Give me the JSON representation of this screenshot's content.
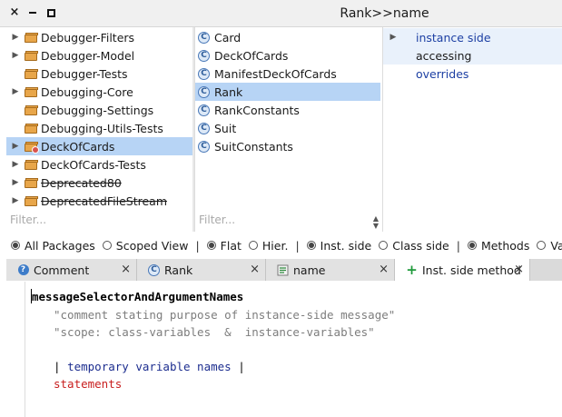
{
  "window": {
    "title": "Rank>>name",
    "close_glyph": "×"
  },
  "packages": {
    "items": [
      {
        "label": "Debugger-Filters",
        "has_arrow": true,
        "selected": false,
        "deprecated": false
      },
      {
        "label": "Debugger-Model",
        "has_arrow": true,
        "selected": false,
        "deprecated": false
      },
      {
        "label": "Debugger-Tests",
        "has_arrow": false,
        "selected": false,
        "deprecated": false
      },
      {
        "label": "Debugging-Core",
        "has_arrow": true,
        "selected": false,
        "deprecated": false
      },
      {
        "label": "Debugging-Settings",
        "has_arrow": false,
        "selected": false,
        "deprecated": false
      },
      {
        "label": "Debugging-Utils-Tests",
        "has_arrow": false,
        "selected": false,
        "deprecated": false
      },
      {
        "label": "DeckOfCards",
        "has_arrow": true,
        "selected": true,
        "deprecated": false
      },
      {
        "label": "DeckOfCards-Tests",
        "has_arrow": true,
        "selected": false,
        "deprecated": false
      },
      {
        "label": "Deprecated80",
        "has_arrow": true,
        "selected": false,
        "deprecated": true
      },
      {
        "label": "DeprecatedFileStream",
        "has_arrow": true,
        "selected": false,
        "deprecated": true
      }
    ],
    "filter_placeholder": "Filter..."
  },
  "classes": {
    "items": [
      {
        "label": "Card",
        "selected": false
      },
      {
        "label": "DeckOfCards",
        "selected": false
      },
      {
        "label": "ManifestDeckOfCards",
        "selected": false
      },
      {
        "label": "Rank",
        "selected": true
      },
      {
        "label": "RankConstants",
        "selected": false
      },
      {
        "label": "Suit",
        "selected": false
      },
      {
        "label": "SuitConstants",
        "selected": false
      }
    ],
    "filter_placeholder": "Filter...",
    "icon_glyph": "C"
  },
  "protocols": {
    "items": [
      {
        "label": "instance side",
        "link": true,
        "arrow": true
      },
      {
        "label": "accessing",
        "link": false,
        "arrow": false
      },
      {
        "label": "overrides",
        "link": true,
        "arrow": false
      }
    ]
  },
  "options": {
    "all_packages": "All Packages",
    "scoped_view": "Scoped View",
    "flat": "Flat",
    "hier": "Hier.",
    "inst_side": "Inst. side",
    "class_side": "Class side",
    "methods": "Methods",
    "vars": "Vars",
    "separator": "|"
  },
  "tabs": [
    {
      "label": "Comment",
      "icon": "question-icon",
      "icon_glyph": "?"
    },
    {
      "label": "Rank",
      "icon": "class-icon",
      "icon_glyph": "C"
    },
    {
      "label": "name",
      "icon": "method-icon",
      "icon_glyph": ""
    },
    {
      "label": "Inst. side method",
      "icon": "plus-icon",
      "icon_glyph": "+"
    }
  ],
  "editor": {
    "signature": "messageSelectorAndArgumentNames",
    "comment_line": "\"comment stating purpose of instance-side message\"",
    "scope_line": "\"scope: class-variables  &  instance-variables\"",
    "temporaries_open": "| ",
    "temporaries_text": "temporary variable names",
    "temporaries_close": " |",
    "statements": "statements"
  },
  "colors": {
    "selection": "#b7d4f5",
    "protocol_link": "#1c3fa3",
    "comment": "#7d7d7d",
    "statements": "#c81e1e"
  }
}
